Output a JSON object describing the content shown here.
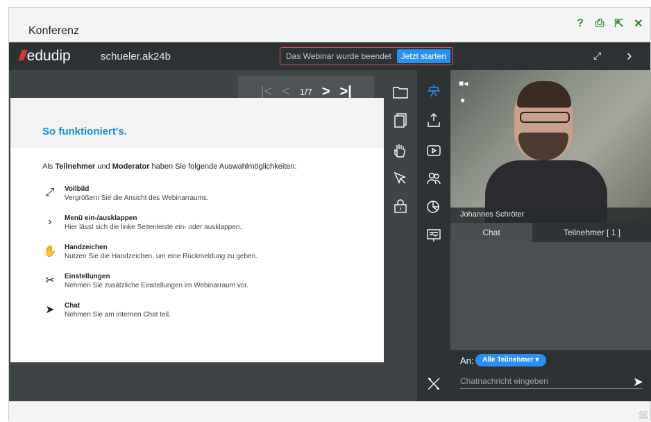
{
  "window": {
    "title": "Konferenz"
  },
  "topbar": {
    "logo_slashes": "///",
    "logo_word": "edudip",
    "room": "schueler.ak24b",
    "status_message": "Das Webinar wurde beendet",
    "start_button": "Jetzt starten",
    "expand_glyph": "⤢",
    "next_glyph": "›"
  },
  "pager": {
    "page_indicator": "1/7",
    "first_glyph": "|<",
    "prev_glyph": "<",
    "next_glyph": ">",
    "last_glyph": ">|"
  },
  "slide": {
    "heading": "So funktioniert's.",
    "intro_prefix": "Als ",
    "intro_role1": "Teilnehmer",
    "intro_mid": " und ",
    "intro_role2": "Moderator",
    "intro_suffix": " haben Sie folgende Auswahlmöglichkeiten:",
    "features": [
      {
        "icon": "fullscreen-icon",
        "title": "Vollbild",
        "desc": "Vergrößern Sie die Ansicht des Webinarraums."
      },
      {
        "icon": "chevron-right-icon",
        "title": "Menü ein-/ausklappen",
        "desc": "Hier lässt sich die linke Seitenleiste ein- oder ausklappen."
      },
      {
        "icon": "hand-icon",
        "title": "Handzeichen",
        "desc": "Nutzen Sie die Handzeichen, um eine Rückmeldung zu geben."
      },
      {
        "icon": "tools-icon",
        "title": "Einstellungen",
        "desc": "Nehmen Sie zusätzliche Einstellungen im Webinarraum vor."
      },
      {
        "icon": "send-icon",
        "title": "Chat",
        "desc": "Nehmen Sie am internen Chat teil."
      }
    ]
  },
  "video": {
    "participant_name": "Johannes Schröter"
  },
  "tabs": {
    "chat": "Chat",
    "participants": "Teilnehmer [ 1 ]"
  },
  "composer": {
    "to_label": "An:",
    "recipient": "Alle Teilnehmer",
    "placeholder": "Chatnachricht eingeben"
  },
  "colors": {
    "accent": "#2a8ff2",
    "heading": "#1c8fd0",
    "window_icons": "#2e8b3a",
    "status_border": "#d9534f"
  }
}
